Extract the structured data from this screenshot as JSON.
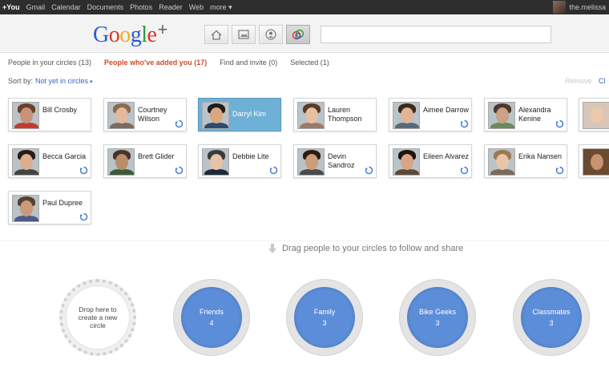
{
  "topbar": {
    "links": [
      "+You",
      "Gmail",
      "Calendar",
      "Documents",
      "Photos",
      "Reader",
      "Web",
      "more ▾"
    ],
    "user": "the.melissa"
  },
  "header": {
    "logo_letters": [
      "G",
      "o",
      "o",
      "g",
      "l",
      "e"
    ],
    "logo_plus": "+",
    "buttons": [
      "home-icon",
      "photos-icon",
      "profile-icon",
      "circles-icon"
    ],
    "search_value": ""
  },
  "tabs": [
    {
      "label": "People in your circles (13)"
    },
    {
      "label": "People who've added you (17)"
    },
    {
      "label": "Find and invite (0)"
    },
    {
      "label": "Selected (1)"
    }
  ],
  "sort": {
    "label": "Sort by:",
    "value": "Not yet in circles",
    "caret": "▾"
  },
  "actions": {
    "remove": "Remove",
    "clear": "Cl"
  },
  "people": [
    {
      "name": "Bill Crosby",
      "face": "#c7937a",
      "hair": "#6b3f2a",
      "body": "#c23b2e"
    },
    {
      "name": "Courtney Wilson",
      "face": "#e3b89e",
      "hair": "#8c6a4e",
      "body": "#7d6b5d"
    },
    {
      "name": "Darryl Kim",
      "face": "#d9a880",
      "hair": "#1c1c1c",
      "body": "#2f4a6a"
    },
    {
      "name": "Lauren Thompson",
      "face": "#e6bfa4",
      "hair": "#5a3a24",
      "body": "#9b7b66"
    },
    {
      "name": "Aimee Darrow",
      "face": "#e2b395",
      "hair": "#3b2a1e",
      "body": "#556b7a"
    },
    {
      "name": "Alexandra Kenine",
      "face": "#c9a287",
      "hair": "#4b3a2c",
      "body": "#6c8a5a"
    },
    {
      "name": "Becca Garcia",
      "face": "#dcae8e",
      "hair": "#2a1c14",
      "body": "#444444"
    },
    {
      "name": "Brett Glider",
      "face": "#b98d6c",
      "hair": "#4a3426",
      "body": "#3c5a3a"
    },
    {
      "name": "Debbie Lite",
      "face": "#e6c2a6",
      "hair": "#3a3a3a",
      "body": "#1e2a3a"
    },
    {
      "name": "Devin Sandroz",
      "face": "#cf9c78",
      "hair": "#2a1d14",
      "body": "#4a4a4a"
    },
    {
      "name": "Eileen Alvarez",
      "face": "#d9a585",
      "hair": "#1e1410",
      "body": "#5a4a3a"
    },
    {
      "name": "Erika Nansen",
      "face": "#e8c4a8",
      "hair": "#9b7a52",
      "body": "#7a6a5a"
    },
    {
      "name": "Paul Dupree",
      "face": "#c99a7c",
      "hair": "#5a4030",
      "body": "#4a5a8a"
    }
  ],
  "drag_hint": "Drag people to your circles to follow and share",
  "new_circle": {
    "label": "Drop here to create a new circle"
  },
  "circles": [
    {
      "name": "Friends",
      "count": "4"
    },
    {
      "name": "Family",
      "count": "3"
    },
    {
      "name": "Bike Geeks",
      "count": "3"
    },
    {
      "name": "Classmates",
      "count": "3"
    }
  ],
  "colors": {
    "accent": "#d14927",
    "link": "#3366cc",
    "circle": "#5b8dd8",
    "selected": "#6fb1d6"
  }
}
